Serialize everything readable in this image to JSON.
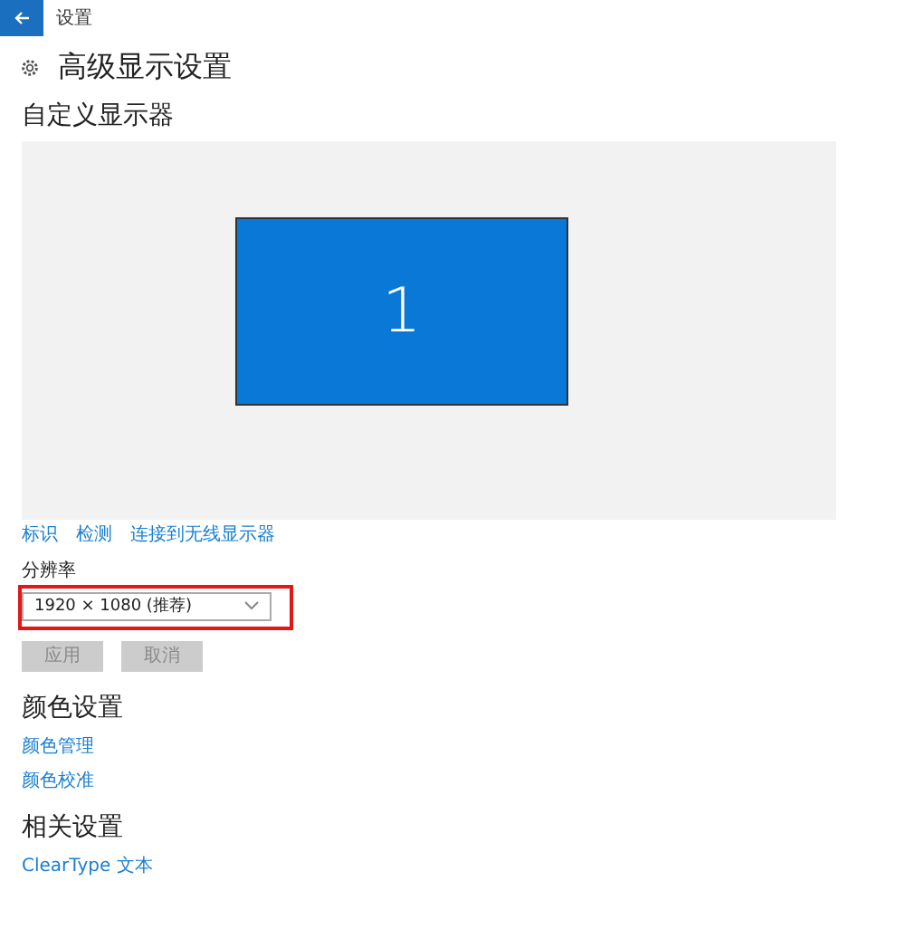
{
  "window": {
    "title": "设置"
  },
  "page_title": "高级显示设置",
  "display_section": {
    "heading": "自定义显示器",
    "monitors": [
      {
        "label": "1",
        "selected": true
      }
    ],
    "links": [
      "标识",
      "检测",
      "连接到无线显示器"
    ]
  },
  "resolution": {
    "label": "分辨率",
    "value": "1920 × 1080 (推荐)",
    "highlighted": true
  },
  "buttons": [
    {
      "label": "应用",
      "disabled": true
    },
    {
      "label": "取消",
      "disabled": true
    }
  ],
  "sections": [
    {
      "heading": "颜色设置",
      "links": [
        "颜色管理",
        "颜色校准"
      ]
    },
    {
      "heading": "相关设置",
      "links": [
        "ClearType 文本"
      ]
    }
  ]
}
